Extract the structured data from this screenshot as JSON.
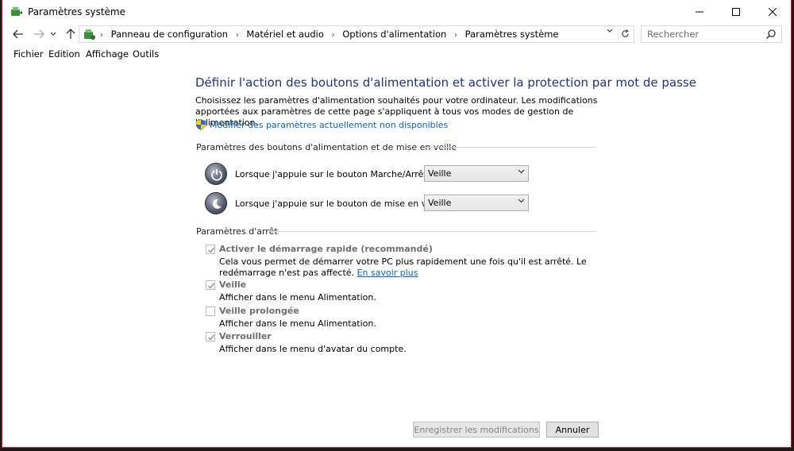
{
  "window": {
    "title": "Paramètres système"
  },
  "address_bar": {
    "breadcrumbs": [
      "Panneau de configuration",
      "Matériel et audio",
      "Options d'alimentation",
      "Paramètres système"
    ],
    "search_placeholder": "Rechercher"
  },
  "menu": {
    "items": [
      "Fichier",
      "Edition",
      "Affichage",
      "Outils"
    ]
  },
  "main": {
    "heading": "Définir l'action des boutons d'alimentation et activer la protection par mot de passe",
    "description": "Choisissez les paramètres d'alimentation souhaités pour votre ordinateur. Les modifications apportées aux paramètres de cette page s'appliquent à tous vos modes de gestion de l'alimentation.",
    "admin_link": "Modifier des paramètres actuellement non disponibles",
    "power_section_title": "Paramètres des boutons d'alimentation et de mise en veille",
    "power_rows": [
      {
        "label": "Lorsque j'appuie sur le bouton Marche/Arrêt :",
        "value": "Veille"
      },
      {
        "label": "Lorsque j'appuie sur le bouton de mise en veille :",
        "value": "Veille"
      }
    ],
    "shutdown_section_title": "Paramètres d'arrêt",
    "options": [
      {
        "title": "Activer le démarrage rapide (recommandé)",
        "desc": "Cela vous permet de démarrer votre PC plus rapidement une fois qu'il est arrêté. Le redémarrage n'est pas affecté.",
        "link": "En savoir plus",
        "checked": true
      },
      {
        "title": "Veille",
        "desc": "Afficher dans le menu Alimentation.",
        "checked": true
      },
      {
        "title": "Veille prolongée",
        "desc": "Afficher dans le menu Alimentation.",
        "checked": false
      },
      {
        "title": "Verrouiller",
        "desc": "Afficher dans le menu d'avatar du compte.",
        "checked": true
      }
    ]
  },
  "footer": {
    "save_label": "Enregistrer les modifications",
    "cancel_label": "Annuler"
  },
  "colors": {
    "heading": "#1e3287",
    "link": "#0066cc",
    "disabled_text": "#6d6d6d"
  }
}
